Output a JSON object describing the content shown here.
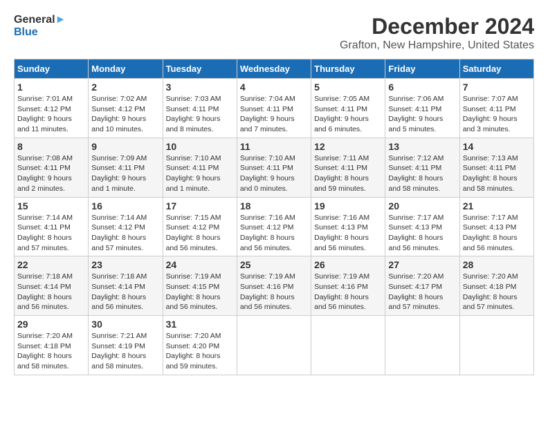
{
  "logo": {
    "line1": "General",
    "line2": "Blue"
  },
  "header": {
    "title": "December 2024",
    "subtitle": "Grafton, New Hampshire, United States"
  },
  "weekdays": [
    "Sunday",
    "Monday",
    "Tuesday",
    "Wednesday",
    "Thursday",
    "Friday",
    "Saturday"
  ],
  "weeks": [
    [
      {
        "day": "1",
        "info": "Sunrise: 7:01 AM\nSunset: 4:12 PM\nDaylight: 9 hours\nand 11 minutes."
      },
      {
        "day": "2",
        "info": "Sunrise: 7:02 AM\nSunset: 4:12 PM\nDaylight: 9 hours\nand 10 minutes."
      },
      {
        "day": "3",
        "info": "Sunrise: 7:03 AM\nSunset: 4:11 PM\nDaylight: 9 hours\nand 8 minutes."
      },
      {
        "day": "4",
        "info": "Sunrise: 7:04 AM\nSunset: 4:11 PM\nDaylight: 9 hours\nand 7 minutes."
      },
      {
        "day": "5",
        "info": "Sunrise: 7:05 AM\nSunset: 4:11 PM\nDaylight: 9 hours\nand 6 minutes."
      },
      {
        "day": "6",
        "info": "Sunrise: 7:06 AM\nSunset: 4:11 PM\nDaylight: 9 hours\nand 5 minutes."
      },
      {
        "day": "7",
        "info": "Sunrise: 7:07 AM\nSunset: 4:11 PM\nDaylight: 9 hours\nand 3 minutes."
      }
    ],
    [
      {
        "day": "8",
        "info": "Sunrise: 7:08 AM\nSunset: 4:11 PM\nDaylight: 9 hours\nand 2 minutes."
      },
      {
        "day": "9",
        "info": "Sunrise: 7:09 AM\nSunset: 4:11 PM\nDaylight: 9 hours\nand 1 minute."
      },
      {
        "day": "10",
        "info": "Sunrise: 7:10 AM\nSunset: 4:11 PM\nDaylight: 9 hours\nand 1 minute."
      },
      {
        "day": "11",
        "info": "Sunrise: 7:10 AM\nSunset: 4:11 PM\nDaylight: 9 hours\nand 0 minutes."
      },
      {
        "day": "12",
        "info": "Sunrise: 7:11 AM\nSunset: 4:11 PM\nDaylight: 8 hours\nand 59 minutes."
      },
      {
        "day": "13",
        "info": "Sunrise: 7:12 AM\nSunset: 4:11 PM\nDaylight: 8 hours\nand 58 minutes."
      },
      {
        "day": "14",
        "info": "Sunrise: 7:13 AM\nSunset: 4:11 PM\nDaylight: 8 hours\nand 58 minutes."
      }
    ],
    [
      {
        "day": "15",
        "info": "Sunrise: 7:14 AM\nSunset: 4:11 PM\nDaylight: 8 hours\nand 57 minutes."
      },
      {
        "day": "16",
        "info": "Sunrise: 7:14 AM\nSunset: 4:12 PM\nDaylight: 8 hours\nand 57 minutes."
      },
      {
        "day": "17",
        "info": "Sunrise: 7:15 AM\nSunset: 4:12 PM\nDaylight: 8 hours\nand 56 minutes."
      },
      {
        "day": "18",
        "info": "Sunrise: 7:16 AM\nSunset: 4:12 PM\nDaylight: 8 hours\nand 56 minutes."
      },
      {
        "day": "19",
        "info": "Sunrise: 7:16 AM\nSunset: 4:13 PM\nDaylight: 8 hours\nand 56 minutes."
      },
      {
        "day": "20",
        "info": "Sunrise: 7:17 AM\nSunset: 4:13 PM\nDaylight: 8 hours\nand 56 minutes."
      },
      {
        "day": "21",
        "info": "Sunrise: 7:17 AM\nSunset: 4:13 PM\nDaylight: 8 hours\nand 56 minutes."
      }
    ],
    [
      {
        "day": "22",
        "info": "Sunrise: 7:18 AM\nSunset: 4:14 PM\nDaylight: 8 hours\nand 56 minutes."
      },
      {
        "day": "23",
        "info": "Sunrise: 7:18 AM\nSunset: 4:14 PM\nDaylight: 8 hours\nand 56 minutes."
      },
      {
        "day": "24",
        "info": "Sunrise: 7:19 AM\nSunset: 4:15 PM\nDaylight: 8 hours\nand 56 minutes."
      },
      {
        "day": "25",
        "info": "Sunrise: 7:19 AM\nSunset: 4:16 PM\nDaylight: 8 hours\nand 56 minutes."
      },
      {
        "day": "26",
        "info": "Sunrise: 7:19 AM\nSunset: 4:16 PM\nDaylight: 8 hours\nand 56 minutes."
      },
      {
        "day": "27",
        "info": "Sunrise: 7:20 AM\nSunset: 4:17 PM\nDaylight: 8 hours\nand 57 minutes."
      },
      {
        "day": "28",
        "info": "Sunrise: 7:20 AM\nSunset: 4:18 PM\nDaylight: 8 hours\nand 57 minutes."
      }
    ],
    [
      {
        "day": "29",
        "info": "Sunrise: 7:20 AM\nSunset: 4:18 PM\nDaylight: 8 hours\nand 58 minutes."
      },
      {
        "day": "30",
        "info": "Sunrise: 7:21 AM\nSunset: 4:19 PM\nDaylight: 8 hours\nand 58 minutes."
      },
      {
        "day": "31",
        "info": "Sunrise: 7:20 AM\nSunset: 4:20 PM\nDaylight: 8 hours\nand 59 minutes."
      },
      {
        "day": "",
        "info": ""
      },
      {
        "day": "",
        "info": ""
      },
      {
        "day": "",
        "info": ""
      },
      {
        "day": "",
        "info": ""
      }
    ]
  ]
}
